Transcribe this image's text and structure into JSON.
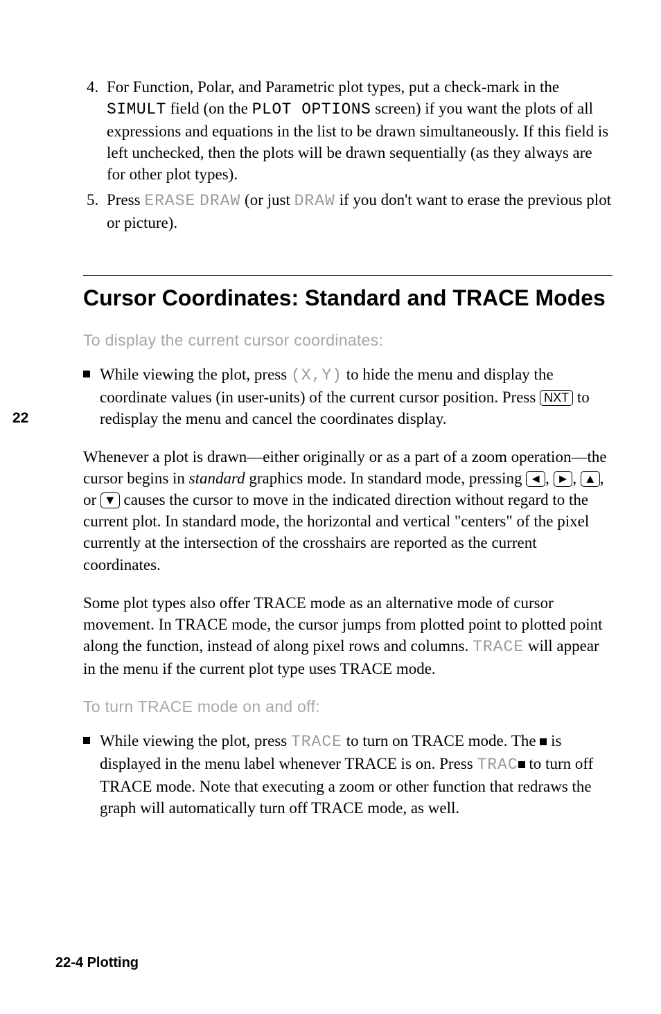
{
  "side_tab": "22",
  "steps": {
    "start": 4,
    "item4": {
      "t1": "For Function, Polar, and Parametric plot types, put a check-mark in the ",
      "simult": "SIMULT",
      "t2": " field (on the ",
      "plotopt": "PLOT OPTIONS",
      "t3": " screen) if you want the plots of all expressions and equations in the list to be drawn simultaneously. If this field is left unchecked, then the plots will be drawn sequentially (as they always are for other plot types)."
    },
    "item5": {
      "t1": "Press ",
      "erase": "ERASE",
      "draw1": "DRAW",
      "t2": " (or just ",
      "draw2": "DRAW",
      "t3": " if you don't want to erase the previous plot or picture)."
    }
  },
  "section_title": "Cursor Coordinates: Standard and TRACE Modes",
  "subhead1": "To display the current cursor coordinates:",
  "bullet1": {
    "t1": "While viewing the plot, press ",
    "xy": "(X,Y)",
    "t2": " to hide the menu and display the coordinate values (in user-units) of the current cursor position. Press ",
    "nxt": "NXT",
    "t3": " to redisplay the menu and cancel the coordinates display."
  },
  "para1": {
    "t1": "Whenever a plot is drawn—either originally or as a part of a zoom operation—the cursor begins in ",
    "standard": "standard",
    "t2": " graphics mode. In standard mode, pressing ",
    "left": "◄",
    "right": "►",
    "up": "▲",
    "down": "▼",
    "t3": " causes the cursor to move in the indicated direction without regard to the current plot. In standard mode, the horizontal and vertical \"centers\" of the pixel currently at the intersection of the crosshairs are reported as the current coordinates."
  },
  "para2": {
    "t1": "Some plot types also offer TRACE mode as an alternative mode of cursor movement. In TRACE mode, the cursor jumps from plotted point to plotted point along the function, instead of along pixel rows and columns. ",
    "trace": "TRACE",
    "t2": " will appear in the menu if the current plot type uses TRACE mode."
  },
  "subhead2": "To turn TRACE mode on and off:",
  "bullet2": {
    "t1": "While viewing the plot, press ",
    "trace1": "TRACE",
    "t2": " to turn on TRACE mode. The ",
    "t3": " is displayed in the menu label whenever TRACE is on. Press ",
    "trac": "TRAC",
    "t4": " to turn off TRACE mode. Note that executing a zoom or other function that redraws the graph will automatically turn off TRACE mode, as well."
  },
  "footer": "22-4  Plotting"
}
